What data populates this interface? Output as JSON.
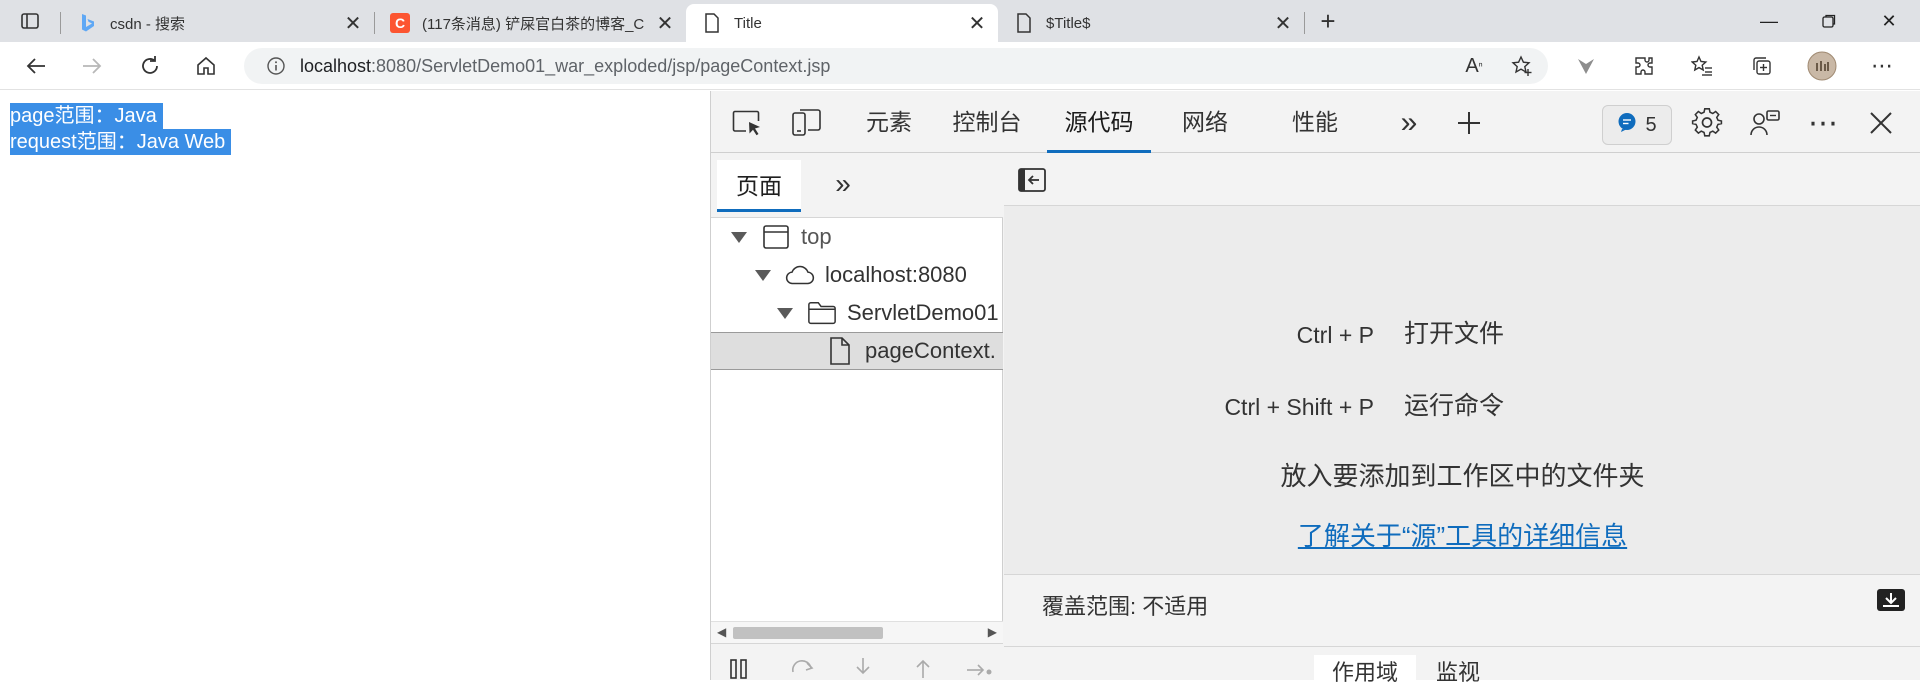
{
  "browser": {
    "tabs": [
      {
        "title": "csdn - 搜索",
        "icon": "bing-icon"
      },
      {
        "title": "(117条消息) 铲屎官白茶的博客_C",
        "icon": "csdn-icon"
      },
      {
        "title": "Title",
        "icon": "page-icon",
        "active": true
      },
      {
        "title": "$Title$",
        "icon": "page-icon"
      }
    ],
    "new_tab_label": "+",
    "address": {
      "host": "localhost",
      "rest": ":8080/ServletDemo01_war_exploded/jsp/pageContext.jsp"
    }
  },
  "page": {
    "lines": [
      "page范围：Java",
      "request范围：Java Web"
    ]
  },
  "devtools": {
    "tabs": [
      "元素",
      "控制台",
      "源代码",
      "网络",
      "性能"
    ],
    "active_tab": "源代码",
    "issues_count": "5",
    "navigator": {
      "tab_label": "页面",
      "tree": [
        "top",
        "localhost:8080",
        "ServletDemo01",
        "pageContext."
      ]
    },
    "editor": {
      "shortcuts": [
        {
          "keys": "Ctrl + P",
          "action": "打开文件"
        },
        {
          "keys": "Ctrl + Shift + P",
          "action": "运行命令"
        }
      ],
      "drop_hint": "放入要添加到工作区中的文件夹",
      "learn_more": "了解关于“源”工具的详细信息",
      "coverage": "覆盖范围: 不适用"
    },
    "scope_tabs": [
      "作用域",
      "监视"
    ]
  },
  "colors": {
    "accent": "#0f6cbd",
    "selection": "#3a8ee6",
    "csdn": "#fc5531"
  }
}
